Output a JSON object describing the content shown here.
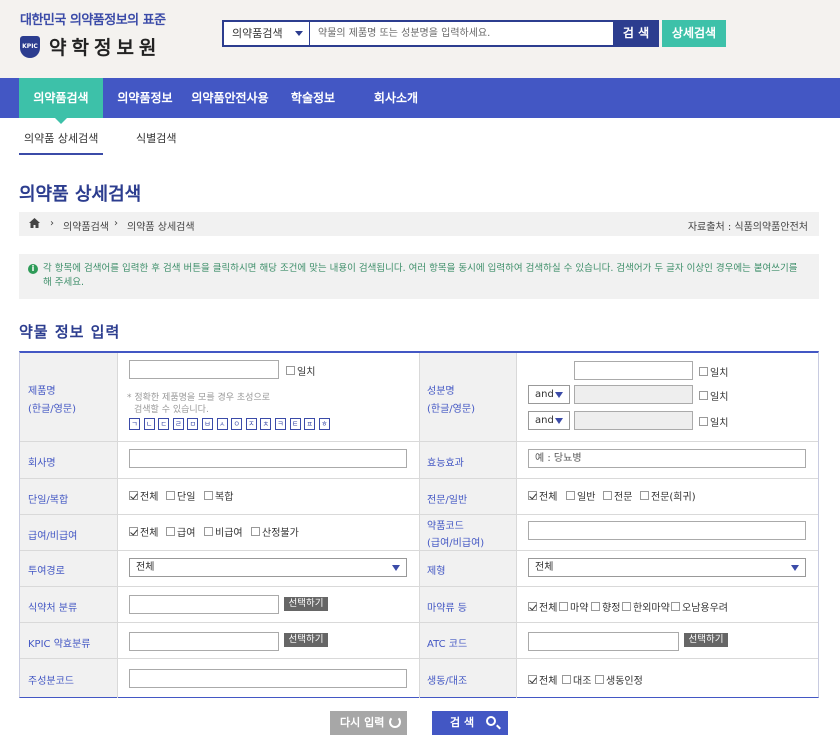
{
  "header": {
    "tagline": "대한민국 의약품정보의 표준",
    "logo_text": "약학정보원",
    "logo_emblem": "KPIC",
    "search_select": "의약품검색",
    "search_placeholder": "약물의 제품명 또는 성분명을 입력하세요.",
    "search_button": "검 색",
    "advanced_button": "상세검색"
  },
  "gnb": {
    "items": [
      "의약품검색",
      "의약품정보",
      "의약품안전사용",
      "학술정보",
      "회사소개"
    ],
    "active_index": 0
  },
  "subnav": {
    "items": [
      "의약품 상세검색",
      "식별검색"
    ],
    "active_index": 0
  },
  "page_title": "의약품 상세검색",
  "breadcrumb": {
    "items": [
      "의약품검색",
      "의약품 상세검색"
    ],
    "source": "자료출처 : 식품의약품안전처"
  },
  "notice": "각 항목에 검색어를 입력한 후 검색 버튼을 클릭하시면 해당 조건에 맞는 내용이 검색됩니다. 여러 항목을 동시에 입력하여 검색하실 수 있습니다. 검색어가 두 글자 이상인 경우에는 붙여쓰기를 해 주세요.",
  "form_title": "약물 정보 입력",
  "form": {
    "product_name_label": "제품명",
    "product_name_sub": "(한글/영문)",
    "exact_label": "일치",
    "hint_line1": "* 정확한 제품명을 모를 경우 초성으로",
    "hint_line2": "검색할 수 있습니다.",
    "initials": [
      "ㄱ",
      "ㄴ",
      "ㄷ",
      "ㄹ",
      "ㅁ",
      "ㅂ",
      "ㅅ",
      "ㅇ",
      "ㅈ",
      "ㅊ",
      "ㅋ",
      "ㅌ",
      "ㅍ",
      "ㅎ"
    ],
    "ingredient_label": "성분명",
    "ingredient_sub": "(한글/영문)",
    "and_label": "and",
    "company_label": "회사명",
    "efficacy_label": "효능효과",
    "efficacy_placeholder": "예 : 당뇨병",
    "single_label": "단일/복합",
    "single_options": [
      "전체",
      "단일",
      "복합"
    ],
    "prof_label": "전문/일반",
    "prof_options": [
      "전체",
      "일반",
      "전문",
      "전문(희귀)"
    ],
    "insurance_label": "급여/비급여",
    "insurance_options": [
      "전체",
      "급여",
      "비급여",
      "산정불가"
    ],
    "drugcode_label": "약품코드",
    "drugcode_sub": "(급여/비급여)",
    "route_label": "투여경로",
    "route_value": "전체",
    "form_label": "제형",
    "form_value": "전체",
    "diet_label": "식약처 분류",
    "select_button": "선택하기",
    "narcotic_label": "마약류 등",
    "narcotic_options": [
      "전체",
      "마약",
      "향정",
      "한외마약",
      "오남용우려"
    ],
    "kpic_label": "KPIC 약효분류",
    "atc_label": "ATC 코드",
    "ingredient_code_label": "주성분코드",
    "bio_label": "생동/대조",
    "bio_options": [
      "전체",
      "대조",
      "생동인정"
    ]
  },
  "buttons": {
    "reset": "다시 입력",
    "submit": "검 색"
  },
  "colors": {
    "brand_blue": "#4357c4",
    "dark_blue": "#2c3d8f",
    "accent_green": "#3dc1a9"
  }
}
